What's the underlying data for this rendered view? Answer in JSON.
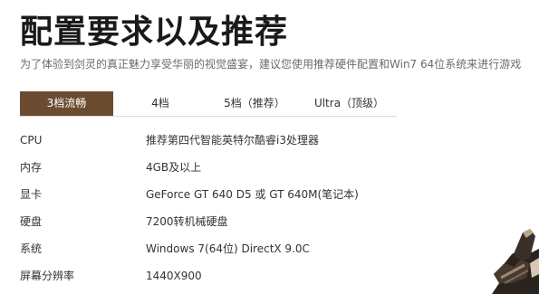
{
  "header": {
    "title": "配置要求以及推荐",
    "subtitle": "为了体验到剑灵的真正魅力享受华丽的视觉盛宴，建议您使用推荐硬件配置和Win7 64位系统来进行游戏"
  },
  "tabs": [
    {
      "label": "3档流畅",
      "active": true
    },
    {
      "label": "4档",
      "active": false
    },
    {
      "label": "5档（推荐）",
      "active": false
    },
    {
      "label": "Ultra（顶级）",
      "active": false
    }
  ],
  "specs": [
    {
      "label": "CPU",
      "value": "推荐第四代智能英特尔酷睿i3处理器"
    },
    {
      "label": "内存",
      "value": "4GB及以上"
    },
    {
      "label": "显卡",
      "value": "GeForce GT 640 D5 或 GT 640M(笔记本)"
    },
    {
      "label": "硬盘",
      "value": "7200转机械硬盘"
    },
    {
      "label": "系统",
      "value": "Windows 7(64位) DirectX 9.0C"
    },
    {
      "label": "屏幕分辨率",
      "value": "1440X900"
    }
  ],
  "colors": {
    "active_tab": "#6b4c30",
    "title": "#1a1a1a",
    "subtitle": "#6b6b6b"
  }
}
